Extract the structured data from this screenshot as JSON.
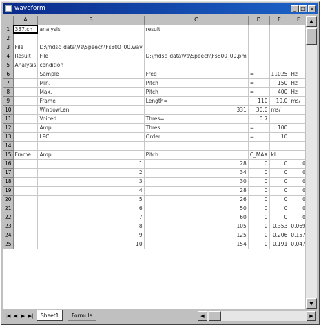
{
  "window": {
    "title": "waveform",
    "min_glyph": "_",
    "max_glyph": "□",
    "close_glyph": "x"
  },
  "sheet": {
    "columns": [
      "A",
      "B",
      "C",
      "D",
      "E",
      "F"
    ],
    "rows": [
      {
        "n": "1",
        "cells": [
          "337.ch",
          "analysis",
          "result",
          "",
          "",
          ""
        ]
      },
      {
        "n": "2",
        "cells": [
          "",
          "",
          "",
          "",
          "",
          ""
        ]
      },
      {
        "n": "3",
        "cells": [
          "File",
          "D:\\mdsc_data\\Vs\\Speech\\Fs800_00.wav",
          "",
          "",
          "",
          ""
        ]
      },
      {
        "n": "4",
        "cells": [
          "Result",
          "File",
          "D:\\mdsc_data\\Vs\\Speech\\Fs800_00.pm",
          "",
          "",
          ""
        ]
      },
      {
        "n": "5",
        "cells": [
          "Analysis",
          "condition",
          "",
          "",
          "",
          ""
        ]
      },
      {
        "n": "6",
        "cells": [
          "",
          "Sample",
          "Freq",
          "=",
          "11025",
          "Hz"
        ]
      },
      {
        "n": "7",
        "cells": [
          "",
          "Min.",
          "Pitch",
          "=",
          "150",
          "Hz"
        ]
      },
      {
        "n": "8",
        "cells": [
          "",
          "Max.",
          "Pitch",
          "=",
          "400",
          "Hz"
        ]
      },
      {
        "n": "9",
        "cells": [
          "",
          "Frame",
          "Length=",
          "110",
          "10.0",
          "ms/"
        ]
      },
      {
        "n": "10",
        "cells": [
          "",
          "WindowLen",
          "331",
          "30.0",
          "ms/",
          ""
        ]
      },
      {
        "n": "11",
        "cells": [
          "",
          "Voiced",
          "Thres=",
          "0.7",
          "",
          ""
        ]
      },
      {
        "n": "12",
        "cells": [
          "",
          "Ampl.",
          "Thres.",
          "=",
          "100",
          ""
        ]
      },
      {
        "n": "13",
        "cells": [
          "",
          "LPC",
          "Order",
          "=",
          "10",
          ""
        ]
      },
      {
        "n": "14",
        "cells": [
          "",
          "",
          "",
          "",
          "",
          ""
        ]
      },
      {
        "n": "15",
        "cells": [
          "Frame",
          "Ampl",
          "Pitch",
          "C_MAX",
          "kl",
          ""
        ]
      },
      {
        "n": "16",
        "cells": [
          "",
          "1",
          "28",
          "0",
          "0",
          "0"
        ]
      },
      {
        "n": "17",
        "cells": [
          "",
          "2",
          "34",
          "0",
          "0",
          "0"
        ]
      },
      {
        "n": "18",
        "cells": [
          "",
          "3",
          "30",
          "0",
          "0",
          "0"
        ]
      },
      {
        "n": "19",
        "cells": [
          "",
          "4",
          "28",
          "0",
          "0",
          "0"
        ]
      },
      {
        "n": "20",
        "cells": [
          "",
          "5",
          "26",
          "0",
          "0",
          "0"
        ]
      },
      {
        "n": "21",
        "cells": [
          "",
          "6",
          "50",
          "0",
          "0",
          "0"
        ]
      },
      {
        "n": "22",
        "cells": [
          "",
          "7",
          "60",
          "0",
          "0",
          "0"
        ]
      },
      {
        "n": "23",
        "cells": [
          "",
          "8",
          "105",
          "0",
          "0.353",
          "0.069"
        ]
      },
      {
        "n": "24",
        "cells": [
          "",
          "9",
          "125",
          "0",
          "0.206",
          "0.157"
        ]
      },
      {
        "n": "25",
        "cells": [
          "",
          "10",
          "154",
          "0",
          "0.191",
          "0.047"
        ]
      }
    ]
  },
  "tabs": {
    "nav": [
      "|◀",
      "◀",
      "▶",
      "▶|"
    ],
    "active": "Sheet1",
    "inactive": "Formula"
  },
  "scroll": {
    "up": "▲",
    "down": "▼",
    "left": "◀",
    "right": "▶"
  }
}
